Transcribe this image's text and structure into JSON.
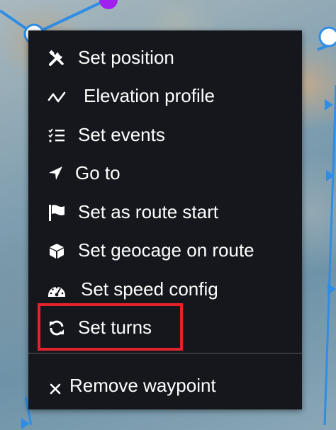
{
  "menu": {
    "items": [
      {
        "label": "Set position",
        "icon": "tools-icon"
      },
      {
        "label": "Elevation profile",
        "icon": "elevation-profile-icon"
      },
      {
        "label": "Set events",
        "icon": "checklist-icon"
      },
      {
        "label": "Go to",
        "icon": "location-arrow-icon"
      },
      {
        "label": "Set as route start",
        "icon": "flag-icon"
      },
      {
        "label": "Set geocage on route",
        "icon": "cube-icon"
      },
      {
        "label": "Set speed config",
        "icon": "speedometer-icon"
      },
      {
        "label": "Set turns",
        "icon": "refresh-icon"
      }
    ],
    "remove_label": "Remove waypoint",
    "remove_icon": "close-icon",
    "highlighted_item": "Set turns"
  },
  "colors": {
    "menu_bg": "#15171c",
    "menu_text": "#ffffff",
    "highlight_border": "#e4222b",
    "route_line": "#2f8de4",
    "waypoint_selected": "#a020f0"
  }
}
